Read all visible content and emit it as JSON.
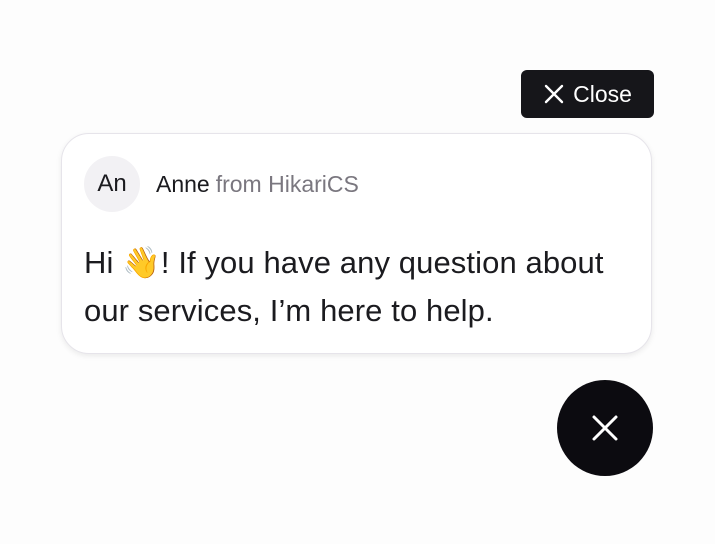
{
  "close_button": {
    "label": "Close",
    "icon": "close-icon"
  },
  "chat_popup": {
    "avatar_initials": "An",
    "sender_name": "Anne",
    "sender_org": "from HikariCS",
    "message_before_emoji": "Hi ",
    "emoji": "👋",
    "message_after_emoji": "! If you have any question about our services, I’m here to help."
  },
  "launcher": {
    "icon": "close-icon",
    "background": "#0c0b10"
  },
  "colors": {
    "dark": "#16161a",
    "text": "#1b1b1f",
    "muted": "#7a777f",
    "card_border": "#e6e4ea"
  }
}
